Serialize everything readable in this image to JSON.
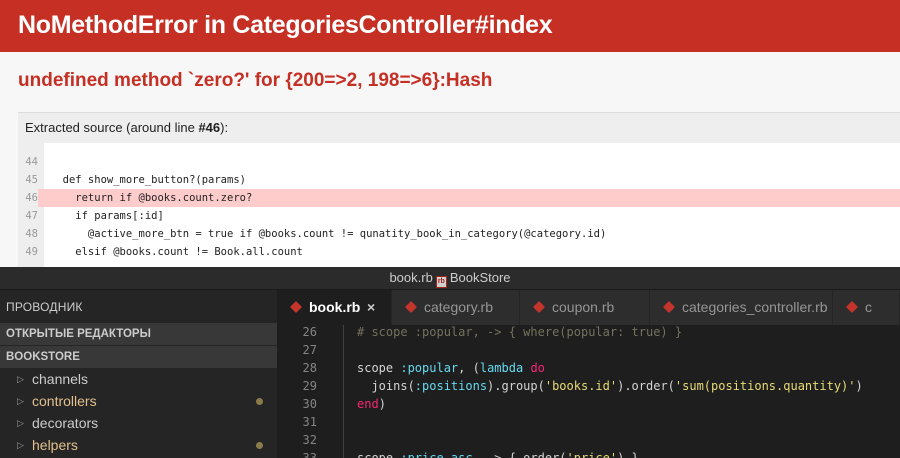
{
  "error_page": {
    "title": "NoMethodError in CategoriesController#index",
    "message": "undefined method `zero?' for {200=>2, 198=>6}:Hash",
    "source_caption_prefix": "Extracted source (around line ",
    "source_caption_line": "#46",
    "source_caption_suffix": "):",
    "highlighted_line": "46",
    "lines": [
      {
        "no": "44",
        "code": ""
      },
      {
        "no": "45",
        "code": "  def show_more_button?(params)"
      },
      {
        "no": "46",
        "code": "    return if @books.count.zero?"
      },
      {
        "no": "47",
        "code": "    if params[:id]"
      },
      {
        "no": "48",
        "code": "      @active_more_btn = true if @books.count != qunatity_book_in_category(@category.id)"
      },
      {
        "no": "49",
        "code": "    elsif @books.count != Book.all.count"
      }
    ]
  },
  "editor": {
    "window_title_file": "book.rb",
    "window_title_project": "BookStore",
    "sidebar": {
      "header": "ПРОВОДНИК",
      "open_editors": "ОТКРЫТЫЕ РЕДАКТОРЫ",
      "project": "BOOKSTORE",
      "items": [
        {
          "name": "channels",
          "modified": false,
          "color": "#cccccc"
        },
        {
          "name": "controllers",
          "modified": true,
          "color": "#e2c08d"
        },
        {
          "name": "decorators",
          "modified": false,
          "color": "#cccccc"
        },
        {
          "name": "helpers",
          "modified": true,
          "color": "#e2c08d"
        }
      ]
    },
    "tabs": [
      {
        "label": "book.rb",
        "active": true,
        "close": "×"
      },
      {
        "label": "category.rb",
        "active": false
      },
      {
        "label": "coupon.rb",
        "active": false
      },
      {
        "label": "categories_controller.rb",
        "active": false
      },
      {
        "label": "c",
        "active": false
      }
    ],
    "code_lines": [
      {
        "no": "26",
        "code": "# scope :popular, -> { where(popular: true) }"
      },
      {
        "no": "27",
        "code": ""
      },
      {
        "no": "28",
        "code": "scope :popular, (lambda do"
      },
      {
        "no": "29",
        "code": "  joins(:positions).group('books.id').order('sum(positions.quantity)')"
      },
      {
        "no": "30",
        "code": "end)"
      },
      {
        "no": "31",
        "code": ""
      },
      {
        "no": "32",
        "code": ""
      },
      {
        "no": "33",
        "code": "scope :price_asc, -> { order('price') }"
      }
    ]
  },
  "colors": {
    "error_red": "#c52f24",
    "highlight": "#ffcccc",
    "editor_bg": "#1e1e1e",
    "sidebar_bg": "#252526"
  }
}
